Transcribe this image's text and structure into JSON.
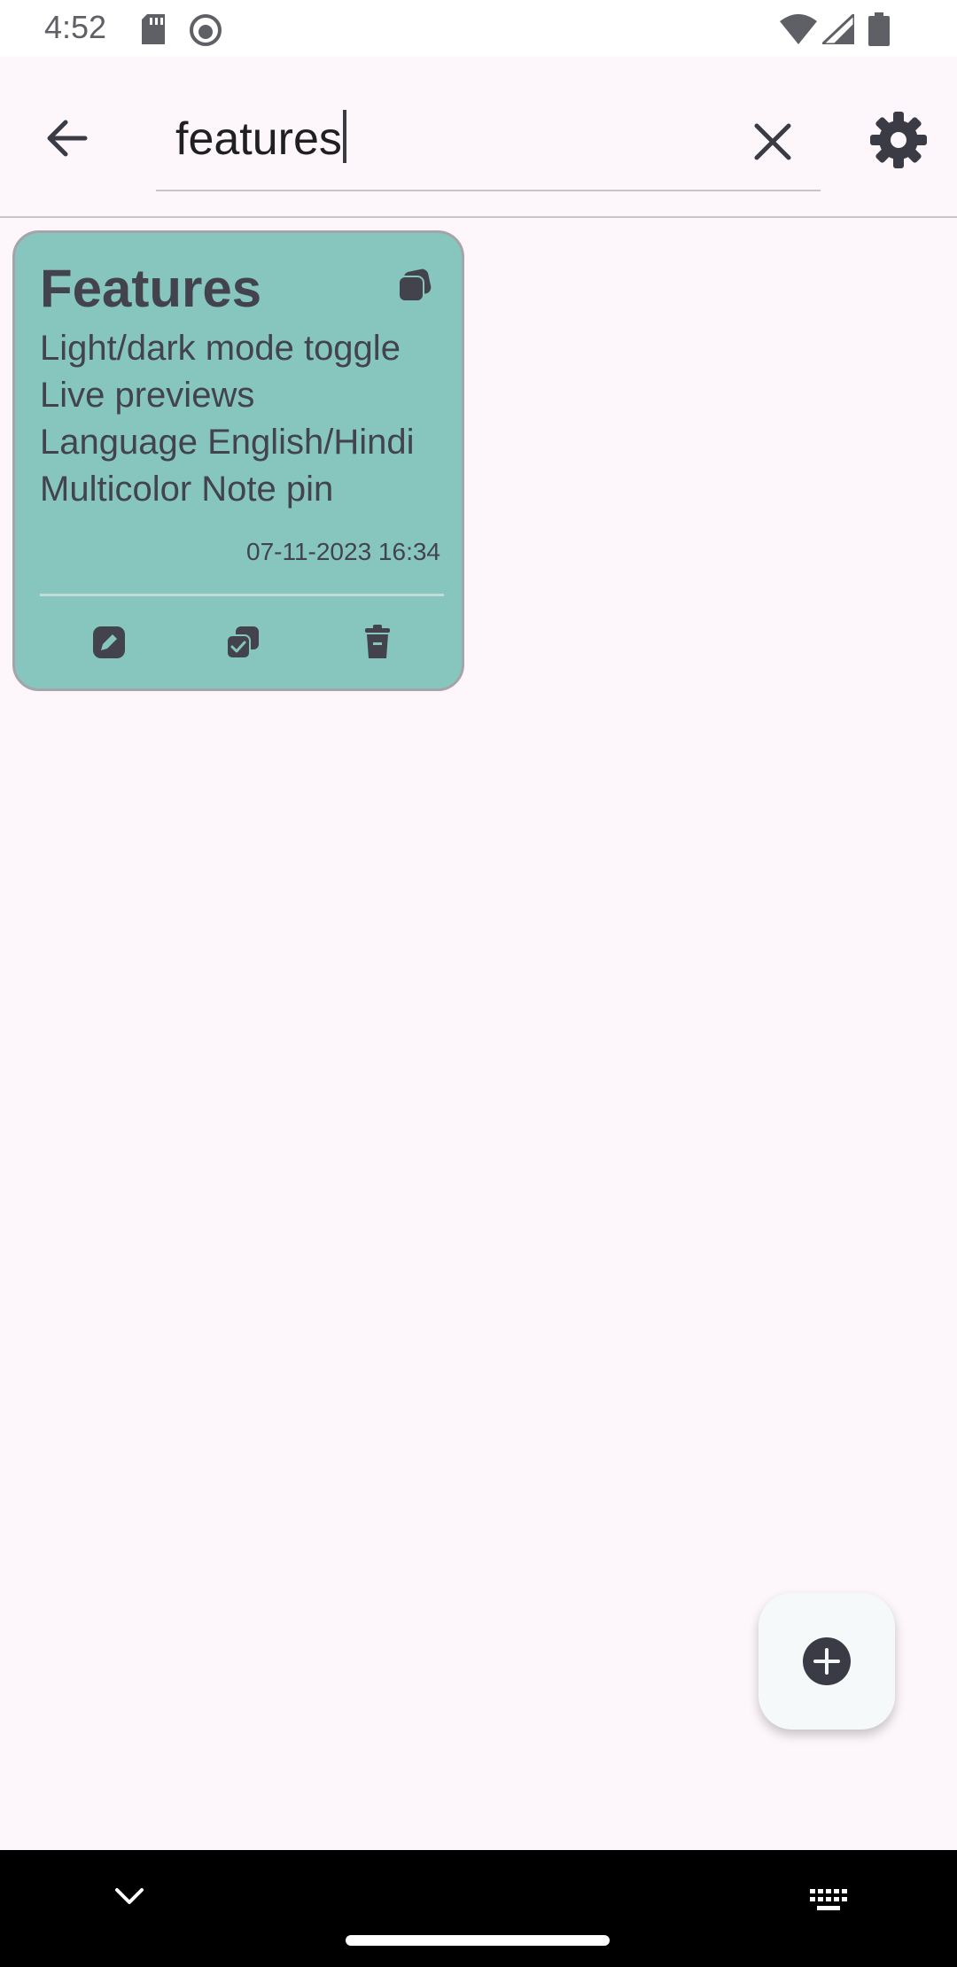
{
  "status_bar": {
    "time": "4:52"
  },
  "search": {
    "query": "features"
  },
  "note": {
    "title": "Features",
    "lines": [
      "Light/dark mode toggle",
      "Live previews",
      "Language English/Hindi",
      "Multicolor Note pin"
    ],
    "date": "07-11-2023 16:34",
    "color": "#87C6BF"
  },
  "icons": {
    "back": "back-arrow-icon",
    "clear": "close-icon",
    "settings": "gear-icon",
    "pin": "pin-icon",
    "edit": "edit-icon",
    "copy": "copy-icon",
    "delete": "trash-icon",
    "add": "plus-icon"
  },
  "colors": {
    "background": "#FDF7FC",
    "card": "#87C6BF",
    "text": "#42434d"
  }
}
